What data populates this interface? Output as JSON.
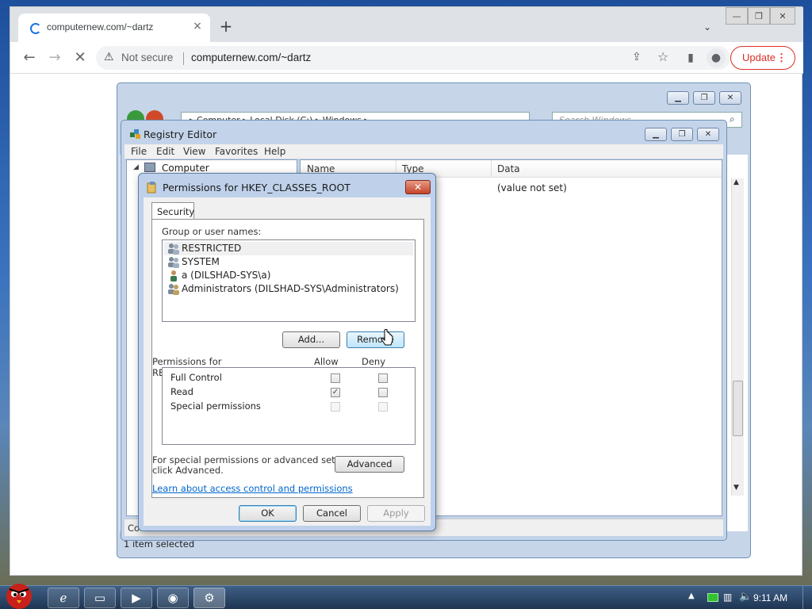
{
  "browser": {
    "tab_title": "computernew.com/~dartz",
    "new_tab": "+",
    "tab_close": "×",
    "not_secure": "Not secure",
    "url": "computernew.com/~dartz",
    "update_label": "Update",
    "window_min": "—",
    "window_max": "❐",
    "window_close": "✕",
    "accent": "#1a73e8",
    "update_color": "#d93025"
  },
  "explorer": {
    "address": "▸  Computer  ▸  Local Disk (C:)  ▸  Windows  ▸",
    "search_placeholder": "Search Windows",
    "status": "1 item selected",
    "status_short": "Co"
  },
  "regedit": {
    "title": "Registry Editor",
    "menu": [
      "File",
      "Edit",
      "View",
      "Favorites",
      "Help"
    ],
    "tree_root": "Computer",
    "columns": [
      "Name",
      "Type",
      "Data"
    ],
    "data_value": "(value not set)"
  },
  "dialog": {
    "title": "Permissions for HKEY_CLASSES_ROOT",
    "tab": "Security",
    "group_label": "Group or user names:",
    "users": [
      "RESTRICTED",
      "SYSTEM",
      "a (DILSHAD-SYS\\a)",
      "Administrators (DILSHAD-SYS\\Administrators)"
    ],
    "add_button": "Add...",
    "remove_button": "Remove",
    "permissions_for": "Permissions for RESTRICTED",
    "allow_header": "Allow",
    "deny_header": "Deny",
    "permissions": [
      {
        "name": "Full Control",
        "allow": false,
        "deny": false
      },
      {
        "name": "Read",
        "allow": true,
        "deny": false
      },
      {
        "name": "Special permissions",
        "allow": false,
        "deny": false
      }
    ],
    "advanced_text_1": "For special permissions or advanced settings,",
    "advanced_text_2": "click Advanced.",
    "advanced_button": "Advanced",
    "learn_link": "Learn about access control and permissions",
    "ok": "OK",
    "cancel": "Cancel",
    "apply": "Apply"
  },
  "taskbar": {
    "clock": "9:11 AM"
  }
}
